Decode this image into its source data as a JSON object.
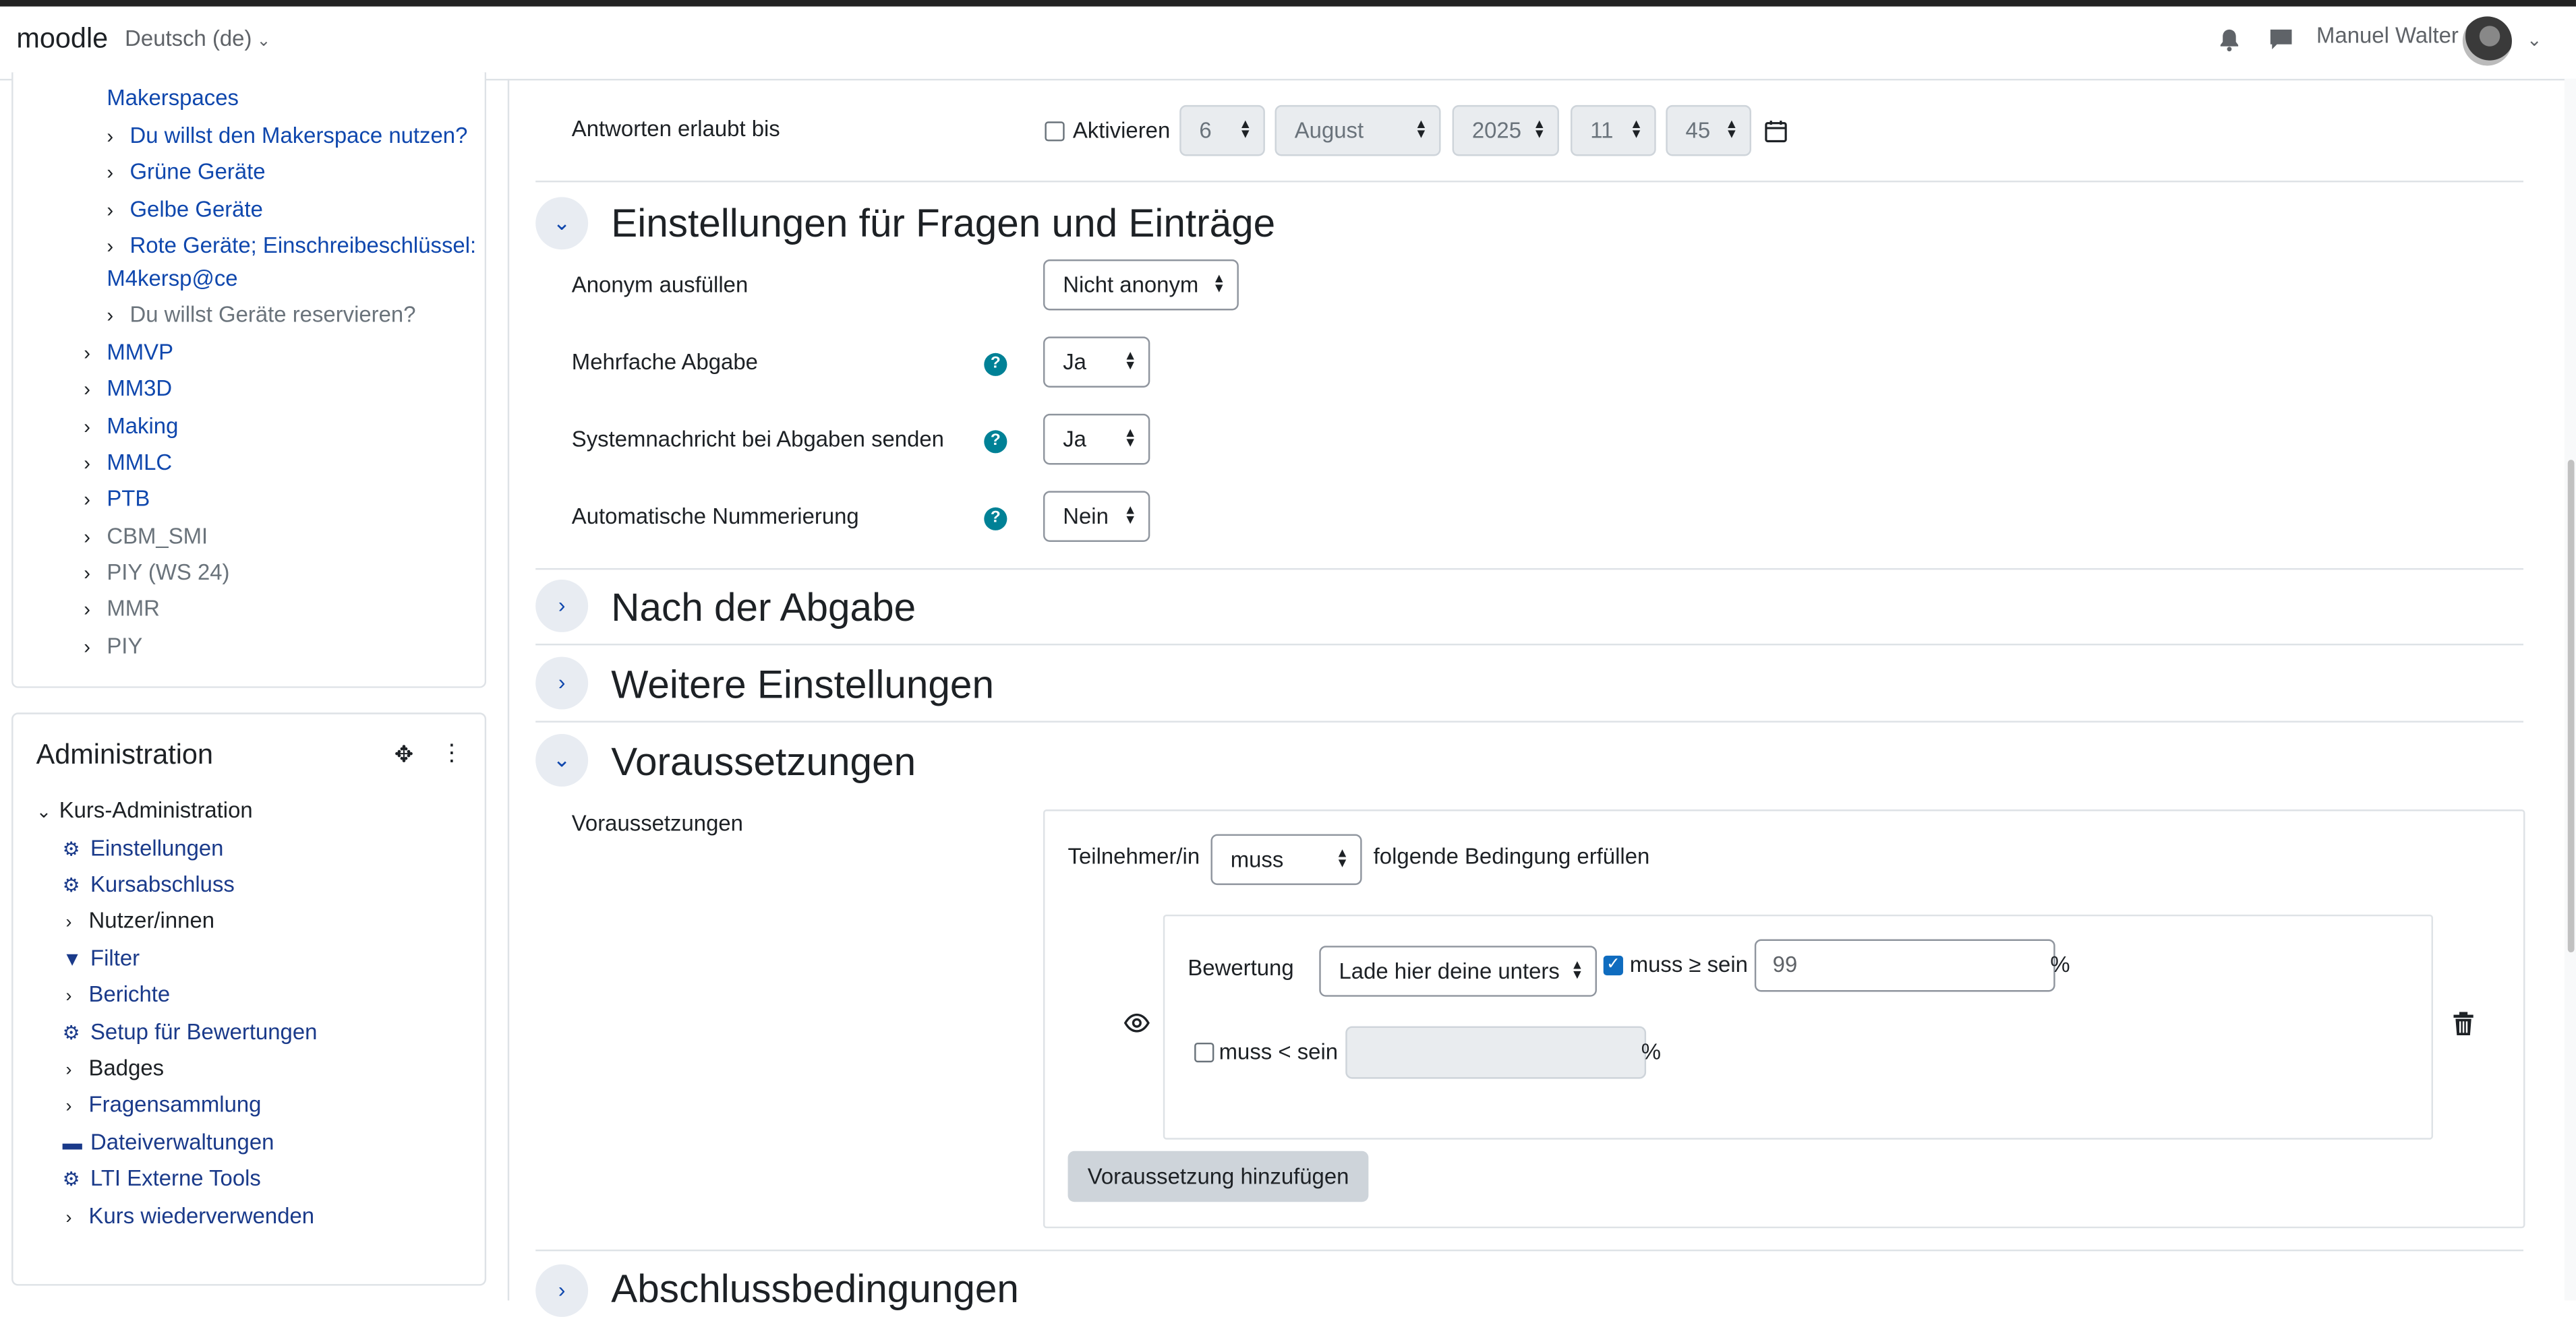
{
  "topbar": {
    "brand": "moodle",
    "language": "Deutsch (de)",
    "user_name": "Manuel Walter"
  },
  "nav_tree": {
    "items": [
      {
        "label": "Makerspaces",
        "caret": false,
        "style": "link"
      },
      {
        "label": "Du willst den Makerspace nutzen?",
        "caret": true,
        "style": "link"
      },
      {
        "label": "Grüne Geräte",
        "caret": true,
        "style": "link"
      },
      {
        "label": "Gelbe Geräte",
        "caret": true,
        "style": "link"
      },
      {
        "label": "Rote Geräte; Einschreibeschlüssel:",
        "caret": true,
        "style": "link"
      },
      {
        "label": "M4kersp@ce",
        "caret": false,
        "style": "link"
      },
      {
        "label": "Du willst Geräte reservieren?",
        "caret": true,
        "style": "muted"
      },
      {
        "label": "MMVP",
        "caret": true,
        "style": "link"
      },
      {
        "label": "MM3D",
        "caret": true,
        "style": "link"
      },
      {
        "label": "Making",
        "caret": true,
        "style": "link"
      },
      {
        "label": "MMLC",
        "caret": true,
        "style": "link"
      },
      {
        "label": "PTB",
        "caret": true,
        "style": "link"
      },
      {
        "label": "CBM_SMI",
        "caret": true,
        "style": "muted"
      },
      {
        "label": "PIY (WS 24)",
        "caret": true,
        "style": "muted"
      },
      {
        "label": "MMR",
        "caret": true,
        "style": "muted"
      },
      {
        "label": "PIY",
        "caret": true,
        "style": "muted"
      }
    ]
  },
  "administration": {
    "title": "Administration",
    "root": "Kurs-Administration",
    "items": [
      {
        "label": "Einstellungen",
        "icon": "gear-icon"
      },
      {
        "label": "Kursabschluss",
        "icon": "gear-icon"
      },
      {
        "label": "Nutzer/innen",
        "icon": "chevron-right-icon"
      },
      {
        "label": "Filter",
        "icon": "filter-icon"
      },
      {
        "label": "Berichte",
        "icon": "chevron-right-icon"
      },
      {
        "label": "Setup für Bewertungen",
        "icon": "gear-icon"
      },
      {
        "label": "Badges",
        "icon": "chevron-right-icon"
      },
      {
        "label": "Fragensammlung",
        "icon": "chevron-right-icon"
      },
      {
        "label": "Dateiverwaltungen",
        "icon": "storage-icon"
      },
      {
        "label": "LTI Externe Tools",
        "icon": "gear-icon"
      },
      {
        "label": "Kurs wiederverwenden",
        "icon": "chevron-right-icon"
      }
    ]
  },
  "answers_until": {
    "label": "Antworten erlaubt bis",
    "enable_label": "Aktivieren",
    "enabled": false,
    "day": "6",
    "month": "August",
    "year": "2025",
    "hour": "11",
    "minute": "45"
  },
  "sections": {
    "questions": {
      "title": "Einstellungen für Fragen und Einträge",
      "anonymous_label": "Anonym ausfüllen",
      "anonymous_value": "Nicht anonym",
      "multiple_label": "Mehrfache Abgabe",
      "multiple_value": "Ja",
      "notify_label": "Systemnachricht bei Abgaben senden",
      "notify_value": "Ja",
      "numbering_label": "Automatische Nummerierung",
      "numbering_value": "Nein"
    },
    "after_submission": {
      "title": "Nach der Abgabe"
    },
    "more_settings": {
      "title": "Weitere Einstellungen"
    },
    "restrictions": {
      "title": "Voraussetzungen",
      "field_label": "Voraussetzungen",
      "participant_label": "Teilnehmer/in",
      "must_value": "muss",
      "condition_text": "folgende Bedingung erfüllen",
      "grade_label": "Bewertung",
      "grade_item_value": "Lade hier deine unters",
      "min_enabled": true,
      "min_label": "muss ≥ sein",
      "min_value": "99",
      "percent": "%",
      "max_enabled": false,
      "max_label": "muss < sein",
      "max_value": "",
      "add_button": "Voraussetzung hinzufügen"
    },
    "completion": {
      "title": "Abschlussbedingungen"
    }
  }
}
